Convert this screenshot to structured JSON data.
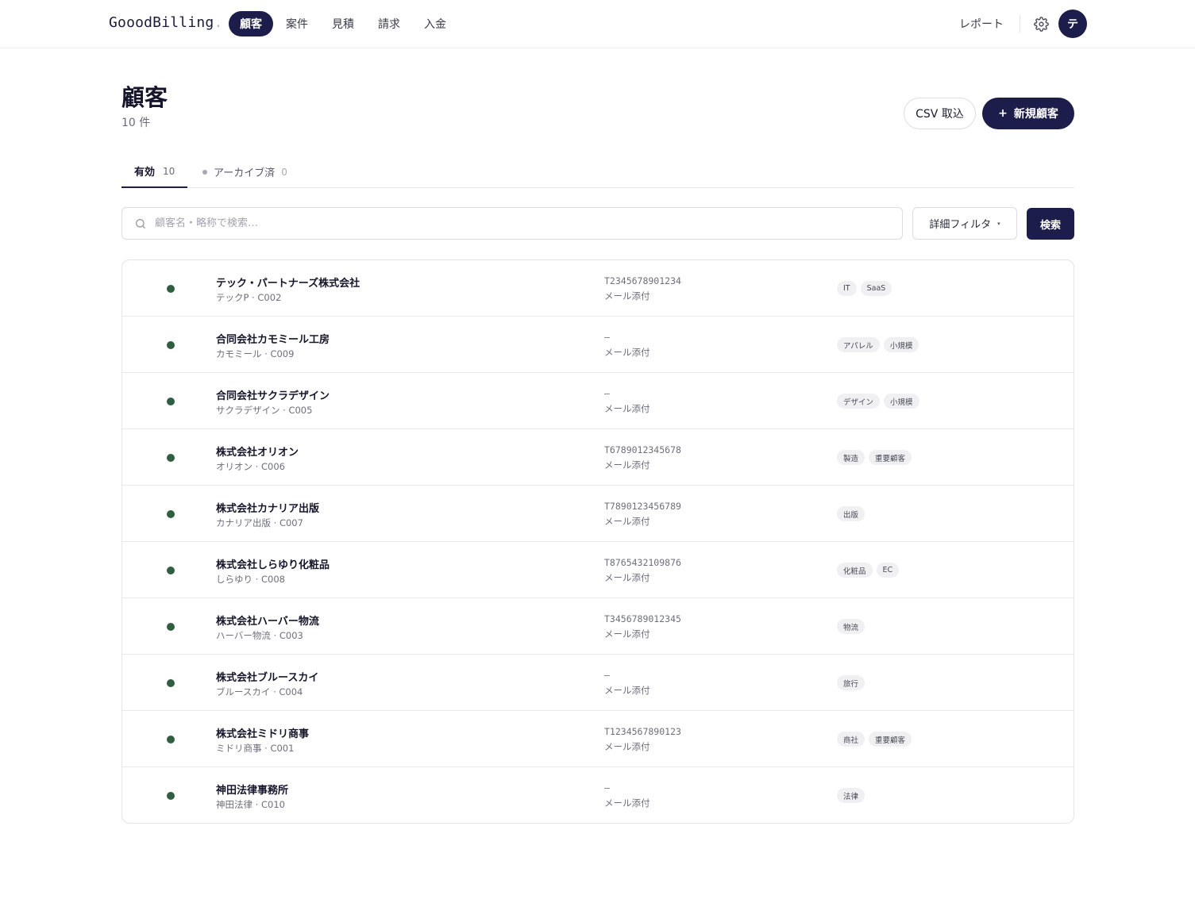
{
  "app": {
    "logo": "GooodBilling",
    "logo_dot": ".",
    "nav": [
      {
        "label": "顧客",
        "active": true
      },
      {
        "label": "案件",
        "active": false
      },
      {
        "label": "見積",
        "active": false
      },
      {
        "label": "請求",
        "active": false
      },
      {
        "label": "入金",
        "active": false
      }
    ],
    "report_label": "レポート",
    "settings_icon": "gear-icon",
    "avatar_initial": "テ"
  },
  "page": {
    "title": "顧客",
    "count_text": "10 件",
    "csv_button": "CSV 取込",
    "new_button_icon": "+",
    "new_button": "新規顧客"
  },
  "tabs": [
    {
      "label": "有効",
      "count": "10",
      "active": true
    },
    {
      "label": "アーカイブ済",
      "count": "0",
      "active": false
    }
  ],
  "search": {
    "placeholder": "顧客名・略称で検索…",
    "value": "",
    "filter_label": "詳細フィルタ",
    "filter_caret": "▾",
    "submit_label": "検索"
  },
  "colors": {
    "accent": "#1c1d4a",
    "status_active": "#2f5e40"
  },
  "customers": [
    {
      "name": "テック・パートナーズ株式会社",
      "sub": "テックP · C002",
      "invoice_no": "T2345678901234",
      "delivery": "メール添付",
      "tags": [
        "IT",
        "SaaS"
      ]
    },
    {
      "name": "合同会社カモミール工房",
      "sub": "カモミール · C009",
      "invoice_no": "—",
      "delivery": "メール添付",
      "tags": [
        "アパレル",
        "小規模"
      ]
    },
    {
      "name": "合同会社サクラデザイン",
      "sub": "サクラデザイン · C005",
      "invoice_no": "—",
      "delivery": "メール添付",
      "tags": [
        "デザイン",
        "小規模"
      ]
    },
    {
      "name": "株式会社オリオン",
      "sub": "オリオン · C006",
      "invoice_no": "T6789012345678",
      "delivery": "メール添付",
      "tags": [
        "製造",
        "重要顧客"
      ]
    },
    {
      "name": "株式会社カナリア出版",
      "sub": "カナリア出版 · C007",
      "invoice_no": "T7890123456789",
      "delivery": "メール添付",
      "tags": [
        "出版"
      ]
    },
    {
      "name": "株式会社しらゆり化粧品",
      "sub": "しらゆり · C008",
      "invoice_no": "T8765432109876",
      "delivery": "メール添付",
      "tags": [
        "化粧品",
        "EC"
      ]
    },
    {
      "name": "株式会社ハーバー物流",
      "sub": "ハーバー物流 · C003",
      "invoice_no": "T3456789012345",
      "delivery": "メール添付",
      "tags": [
        "物流"
      ]
    },
    {
      "name": "株式会社ブルースカイ",
      "sub": "ブルースカイ · C004",
      "invoice_no": "—",
      "delivery": "メール添付",
      "tags": [
        "旅行"
      ]
    },
    {
      "name": "株式会社ミドリ商事",
      "sub": "ミドリ商事 · C001",
      "invoice_no": "T1234567890123",
      "delivery": "メール添付",
      "tags": [
        "商社",
        "重要顧客"
      ]
    },
    {
      "name": "神田法律事務所",
      "sub": "神田法律 · C010",
      "invoice_no": "—",
      "delivery": "メール添付",
      "tags": [
        "法律"
      ]
    }
  ]
}
